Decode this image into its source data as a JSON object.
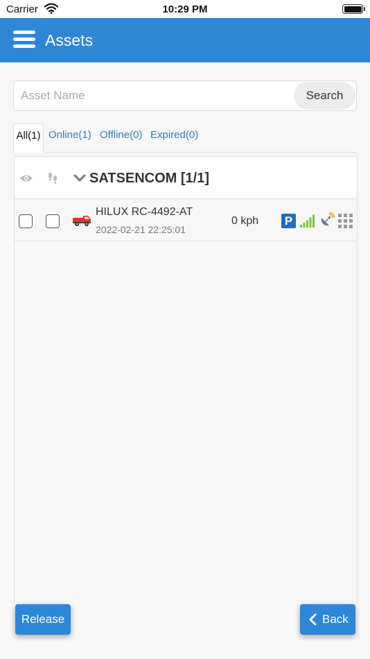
{
  "status_bar": {
    "carrier": "Carrier",
    "time": "10:29 PM"
  },
  "header": {
    "title": "Assets"
  },
  "search": {
    "placeholder": "Asset Name",
    "value": "",
    "button_label": "Search"
  },
  "tabs": [
    {
      "label": "All(1)",
      "active": true
    },
    {
      "label": "Online(1)",
      "active": false
    },
    {
      "label": "Offline(0)",
      "active": false
    },
    {
      "label": "Expired(0)",
      "active": false
    }
  ],
  "group": {
    "title": "SATSENCOM [1/1]"
  },
  "assets": [
    {
      "name": "HILUX RC-4492-AT",
      "timestamp": "2022-02-21 22:25:01",
      "speed": "0 kph",
      "parking_badge": "P",
      "icons": [
        "truck-icon",
        "parking-icon",
        "signal-icon",
        "satellite-icon",
        "grid-icon"
      ]
    }
  ],
  "footer": {
    "release_label": "Release",
    "back_label": "Back"
  },
  "colors": {
    "primary": "#2e86d6",
    "link": "#337ab7",
    "parking": "#1e6fc0",
    "signal": "#7ec242"
  }
}
